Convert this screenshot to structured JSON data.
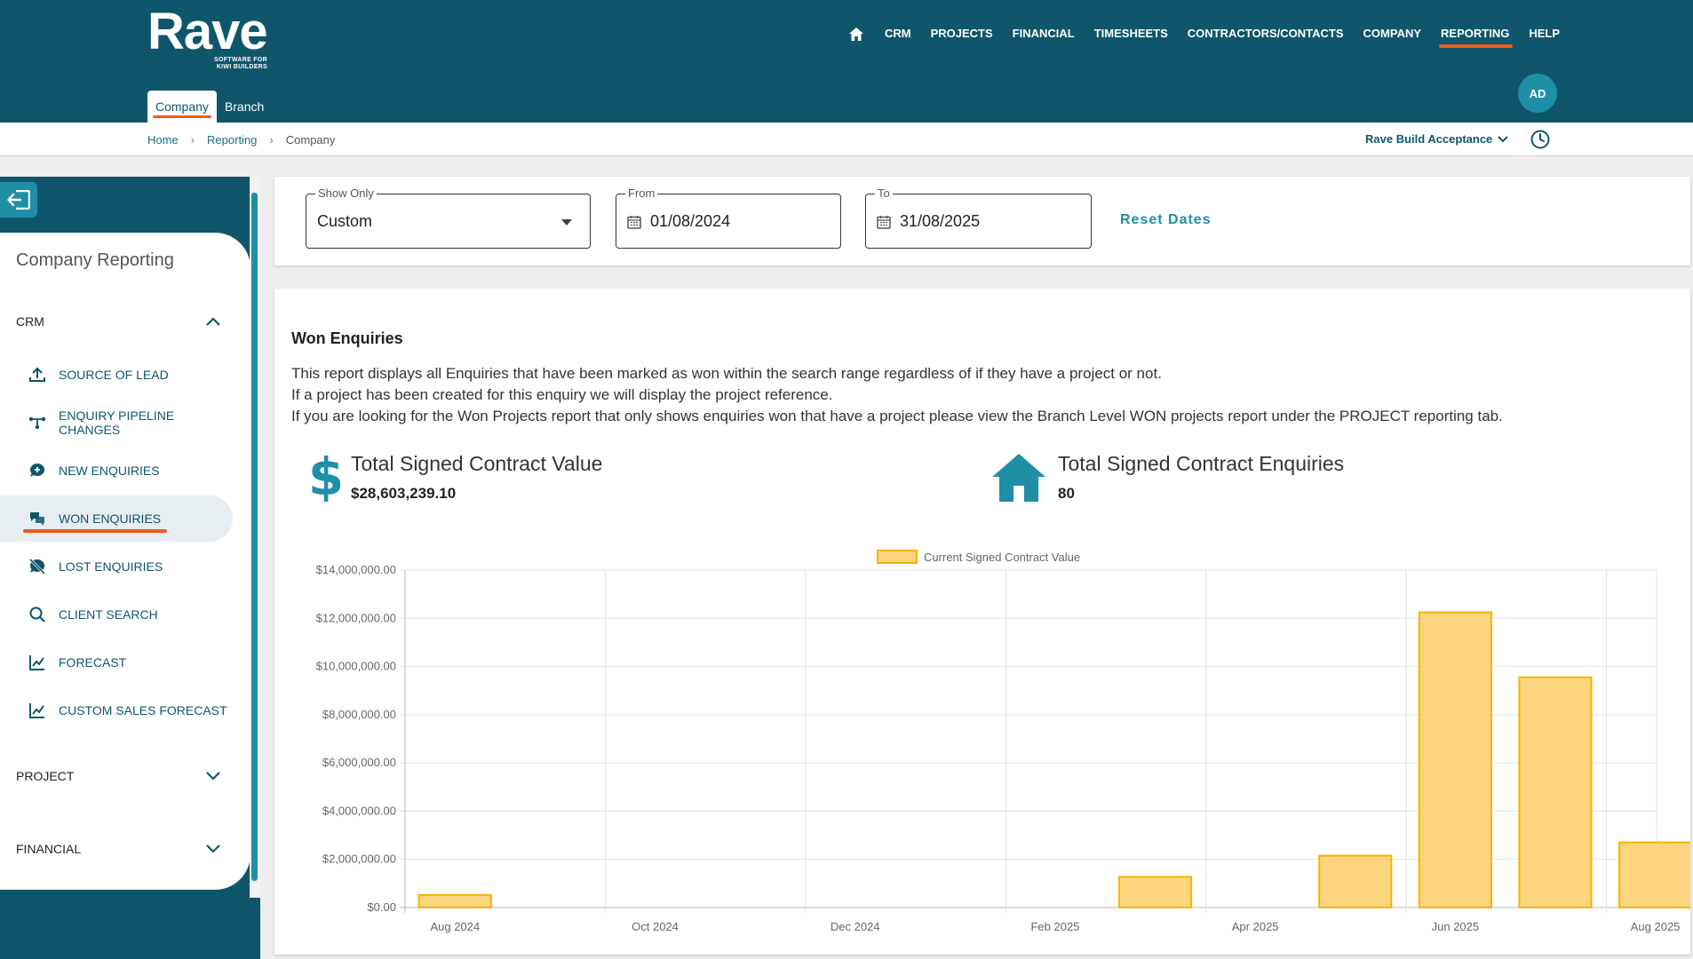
{
  "brand": {
    "name": "Rave",
    "tagline_line1": "SOFTWARE FOR",
    "tagline_line2": "KIWI BUILDERS"
  },
  "topnav": {
    "items": [
      {
        "label": "CRM"
      },
      {
        "label": "PROJECTS"
      },
      {
        "label": "FINANCIAL"
      },
      {
        "label": "TIMESHEETS"
      },
      {
        "label": "CONTRACTORS/CONTACTS"
      },
      {
        "label": "COMPANY"
      },
      {
        "label": "REPORTING"
      },
      {
        "label": "HELP"
      }
    ],
    "active": "REPORTING"
  },
  "subtabs": [
    {
      "label": "Company"
    },
    {
      "label": "Branch"
    }
  ],
  "user": {
    "initials": "AD"
  },
  "breadcrumb": {
    "home": "Home",
    "reporting": "Reporting",
    "current": "Company",
    "sep": "›"
  },
  "branch": {
    "selected": "Rave Build Acceptance"
  },
  "sidebar": {
    "title": "Company Reporting",
    "sections": {
      "crm": "CRM",
      "project": "PROJECT",
      "financial": "FINANCIAL"
    },
    "items": [
      {
        "label": "SOURCE OF LEAD",
        "icon": "upload-icon"
      },
      {
        "label": "ENQUIRY PIPELINE CHANGES",
        "icon": "pipeline-icon"
      },
      {
        "label": "NEW ENQUIRIES",
        "icon": "chat-plus-icon"
      },
      {
        "label": "WON ENQUIRIES",
        "icon": "chat-bubbles-icon"
      },
      {
        "label": "LOST ENQUIRIES",
        "icon": "chat-off-icon"
      },
      {
        "label": "CLIENT SEARCH",
        "icon": "search-icon"
      },
      {
        "label": "FORECAST",
        "icon": "chart-line-icon"
      },
      {
        "label": "CUSTOM SALES FORECAST",
        "icon": "chart-line-icon"
      }
    ],
    "active": "WON ENQUIRIES"
  },
  "filters": {
    "show_only": {
      "label": "Show Only",
      "value": "Custom"
    },
    "from": {
      "label": "From",
      "value": "01/08/2024"
    },
    "to": {
      "label": "To",
      "value": "31/08/2025"
    },
    "reset_label": "Reset Dates"
  },
  "report": {
    "title": "Won Enquiries",
    "desc_1": "This report displays all Enquiries that have been marked as won within the search range regardless of if they have a project or not.",
    "desc_2": "If a project has been created for this enquiry we will display the project reference.",
    "desc_3": "If you are looking for the Won Projects report that only shows enquiries won that have a project please view the Branch Level WON projects report under the PROJECT reporting tab.",
    "kpi_value_title": "Total Signed Contract Value",
    "kpi_value": "$28,603,239.10",
    "kpi_count_title": "Total Signed Contract Enquiries",
    "kpi_count": "80"
  },
  "colors": {
    "bar_fill": "#fdd57e",
    "bar_stroke": "#f4b400",
    "brand": "#0f566b",
    "accent": "#1f8fa7",
    "underline": "#f05a1a"
  },
  "chart_data": {
    "type": "bar",
    "legend": "Current Signed Contract Value",
    "legend_position": "top",
    "categories": [
      "Aug 2024",
      "Sep 2024",
      "Oct 2024",
      "Nov 2024",
      "Dec 2024",
      "Jan 2025",
      "Feb 2025",
      "Mar 2025",
      "Apr 2025",
      "May 2025",
      "Jun 2025",
      "Jul 2025",
      "Aug 2025"
    ],
    "x_tick_labels": [
      "Aug 2024",
      "",
      "Oct 2024",
      "",
      "Dec 2024",
      "",
      "Feb 2025",
      "",
      "Apr 2025",
      "",
      "Jun 2025",
      "",
      "Aug 2025"
    ],
    "values": [
      520000,
      0,
      0,
      0,
      0,
      0,
      0,
      1270000,
      0,
      2150000,
      12250000,
      9550000,
      2700000
    ],
    "ylim": [
      0,
      14000000
    ],
    "y_ticks": [
      0,
      2000000,
      4000000,
      6000000,
      8000000,
      10000000,
      12000000,
      14000000
    ],
    "y_tick_labels": [
      "$0.00",
      "$2,000,000.00",
      "$4,000,000.00",
      "$6,000,000.00",
      "$8,000,000.00",
      "$10,000,000.00",
      "$12,000,000.00",
      "$14,000,000.00"
    ],
    "grid": true
  }
}
